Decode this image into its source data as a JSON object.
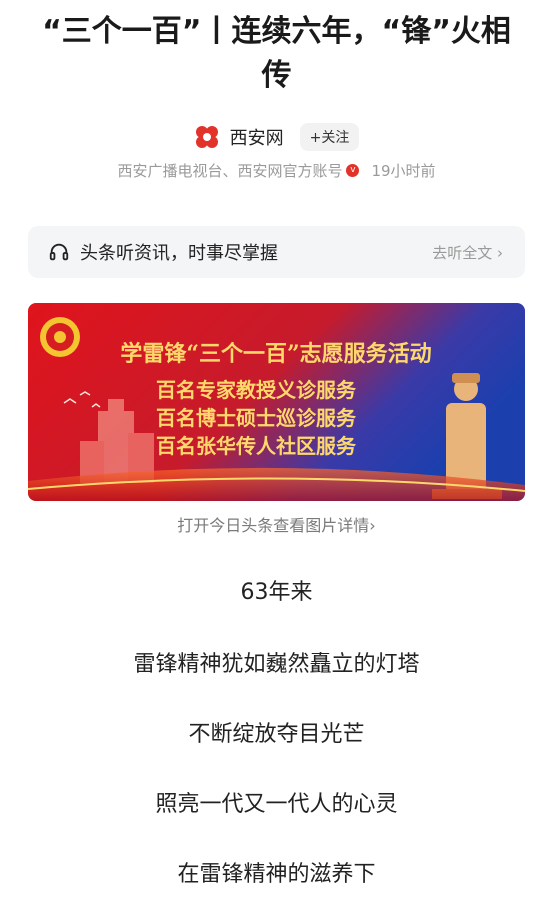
{
  "article": {
    "title": "“三个一百”丨连续六年，“锋”火相传",
    "author": "西安网",
    "follow_label": "+关注",
    "meta_text": "西安广播电视台、西安网官方账号",
    "time": "19小时前"
  },
  "listen": {
    "text": "头条听资讯，时事尽掌握",
    "link": "去听全文 ›"
  },
  "banner": {
    "headline": "学雷锋“三个一百”志愿服务活动",
    "lines": [
      "百名专家教授义诊服务",
      "百名博士硕士巡诊服务",
      "百名张华传人社区服务"
    ]
  },
  "image_caption": "打开今日头条查看图片详情›",
  "body": [
    "63年来",
    "雷锋精神犹如巍然矗立的灯塔",
    "不断绽放夺目光芒",
    "照亮一代又一代人的心灵",
    "在雷锋精神的滋养下"
  ],
  "colors": {
    "brand_red": "#e2332a",
    "banner_red": "#d8161c",
    "banner_blue": "#1c3fae",
    "banner_gold": "#ffd86b"
  }
}
